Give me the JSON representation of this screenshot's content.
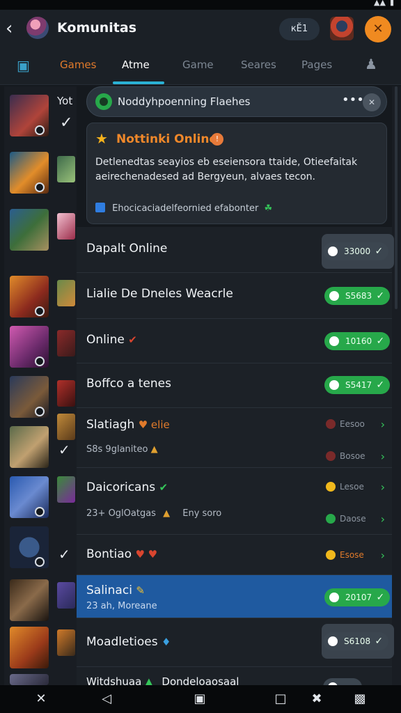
{
  "status_bar": {
    "signal": "▲▲",
    "battery": "▮"
  },
  "header": {
    "back": "‹",
    "title": "Komunitas",
    "pill": "кӖ1",
    "badge": "✕"
  },
  "tabs": [
    "Games",
    "Atme",
    "Game",
    "Seares",
    "Pages"
  ],
  "popup": {
    "title": "Noddyhpoenning Flaehes",
    "more": "•••",
    "close": "✕",
    "card_title": "Nottinki Online",
    "card_badge": "!",
    "card_body": "Detlenedtas seayios eb eseiensora ttaide, Otieefaitak aeirechenadesed ad Bergyeun, alvaes tecon.",
    "card_footer": "Ehocicaciadelfeornied efabonter",
    "leaf": "☘"
  },
  "left_strip": {
    "labels": [
      "Yot"
    ]
  },
  "rows": [
    {
      "name": "Dapalt Online",
      "sub": "",
      "status": "33000",
      "kind": "grey-box"
    },
    {
      "name": "Lialie De Dneles Weacrle",
      "sub": "",
      "status": "S5683",
      "kind": "green"
    },
    {
      "name": "Online",
      "emoji": "✔",
      "sub": "",
      "status": "10160",
      "kind": "green"
    },
    {
      "name": "Boffco a tenes",
      "sub": "",
      "status": "S5417",
      "kind": "green"
    },
    {
      "name": "Slatiagh",
      "emoji": "♥ elie",
      "sub": "S8s 9glaniteo",
      "sub_emoji": "▲",
      "status": "Eesoo",
      "status2": "Bosoe",
      "kind": "alt"
    },
    {
      "name": "Daicoricans",
      "emoji": "✔",
      "sub": "23+ OglOatgas",
      "sub_emoji": "▲",
      "sub_extra": "Eny soro",
      "status": "Lesoe",
      "status2": "Daose",
      "kind": "alt"
    },
    {
      "name": "Bontiao",
      "emoji": "♥ ♥",
      "sub": "",
      "status": "Esose",
      "kind": "alt-single"
    },
    {
      "name": "Salinaci",
      "emoji": "✎",
      "sub": "23 ah, Moreane",
      "status": "20107",
      "kind": "green-selected"
    },
    {
      "name": "Moadletioes",
      "emoji": "♦",
      "sub": "",
      "status": "S6108",
      "kind": "grey-box"
    },
    {
      "name": "Witdshuaa",
      "emoji": "▲",
      "sub_extra": "Dondeloaosaal",
      "sub": "",
      "status": "",
      "kind": "partial"
    }
  ],
  "bottom_nav": [
    "✕",
    "◁",
    "▣",
    "□",
    "✖",
    "▩"
  ],
  "colors": {
    "accent_green": "#27a84a",
    "accent_orange": "#f0882a",
    "selected": "#1f5aa0",
    "tab_active": "#2bb1d4"
  }
}
